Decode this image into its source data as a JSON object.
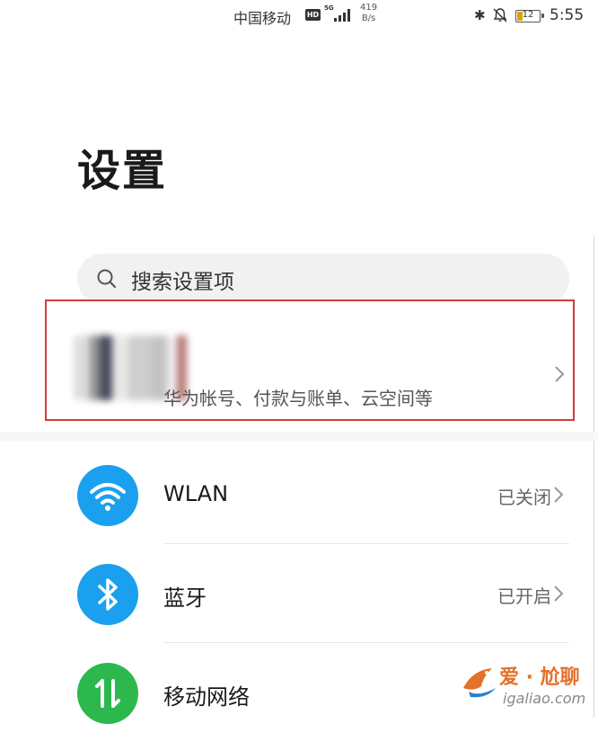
{
  "status_bar": {
    "carrier": "中国移动",
    "hd_badge": "HD",
    "network_type": "5G",
    "speed_value": "419",
    "speed_unit": "B/s",
    "battery": "12",
    "time": "5:55",
    "icons": [
      "bluetooth-icon",
      "bell-off-icon",
      "battery-icon",
      "signal-icon"
    ]
  },
  "page": {
    "title": "设置"
  },
  "search": {
    "placeholder": "搜索设置项"
  },
  "account": {
    "subtitle": "华为帐号、付款与账单、云空间等"
  },
  "rows": [
    {
      "label": "WLAN",
      "status": "已关闭",
      "icon": "wifi-icon",
      "color": "#1aa0ee"
    },
    {
      "label": "蓝牙",
      "status": "已开启",
      "icon": "bluetooth-icon",
      "color": "#1aa0ee"
    },
    {
      "label": "移动网络",
      "status": "",
      "icon": "mobile-data-icon",
      "color": "#2db84d"
    }
  ],
  "watermark": {
    "title": "爱 · 尬聊",
    "url": "igaliao.com"
  },
  "colors": {
    "highlight_border": "#d23c3c",
    "accent_blue": "#1aa0ee",
    "accent_green": "#2db84d"
  }
}
